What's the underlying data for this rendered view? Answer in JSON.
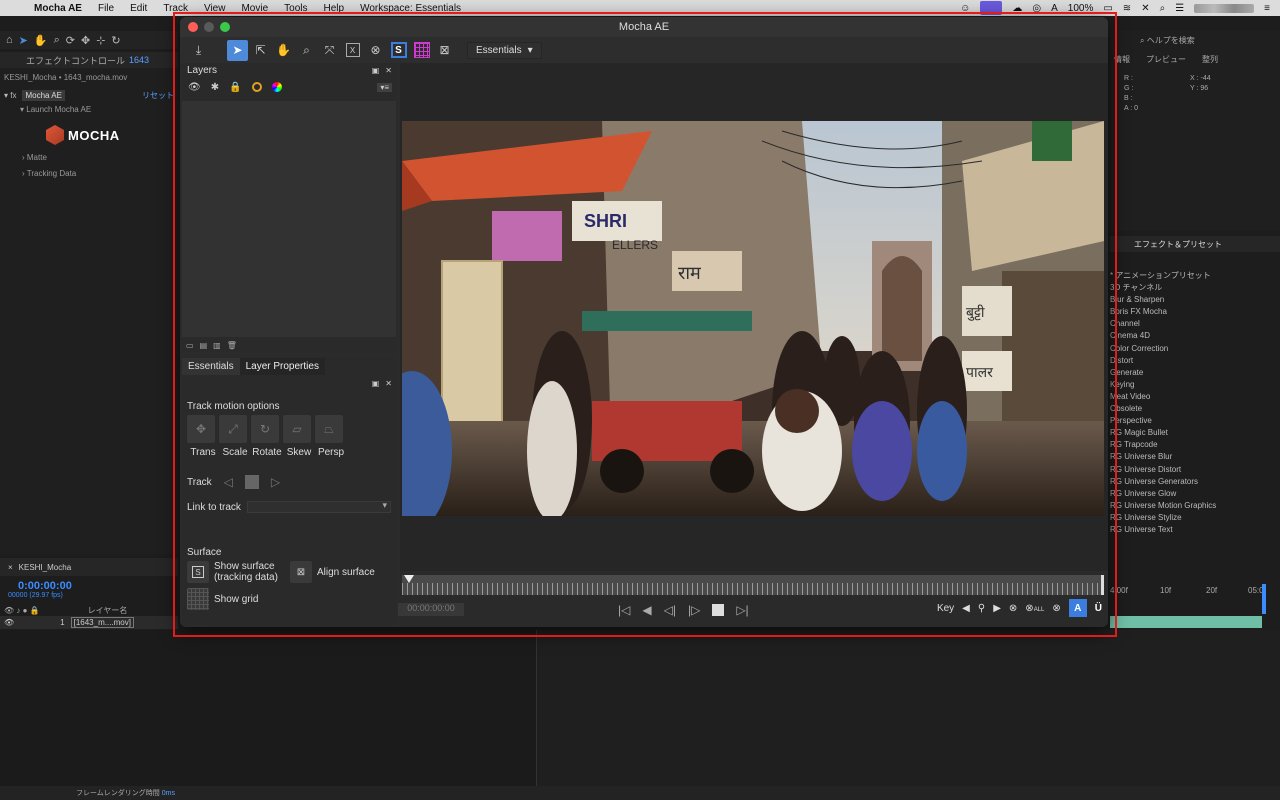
{
  "menubar": {
    "app": "Mocha AE",
    "items": [
      "File",
      "Edit",
      "Track",
      "View",
      "Movie",
      "Tools",
      "Help",
      "Workspace: Essentials"
    ],
    "battery": "100%"
  },
  "ae": {
    "effect_tab": "エフェクトコントロール",
    "effect_tab_suffix": "1643",
    "comp_path": "KESHI_Mocha • 1643_mocha.mov",
    "fx_name": "Mocha AE",
    "reset": "リセット",
    "launch": "Launch Mocha AE",
    "mocha_logo": "MOCHA",
    "tree_items": [
      "Matte",
      "Tracking Data"
    ],
    "search_placeholder": "ヘルプを検索",
    "info_tabs": [
      "情報",
      "プレビュー",
      "整列"
    ],
    "rgb": [
      "R :",
      "G :",
      "B :",
      "A : 0"
    ],
    "xy": [
      "X : -44",
      "Y : 96"
    ],
    "effects_header": "エフェクト＆プリセット",
    "effects_list": [
      "* アニメーションプリセット",
      "3D チャンネル",
      "Blur & Sharpen",
      "Boris FX Mocha",
      "Channel",
      "Cinema 4D",
      "Color Correction",
      "Distort",
      "Generate",
      "Keying",
      "Meat Video",
      "Obsolete",
      "Perspective",
      "RG Magic Bullet",
      "RG Trapcode",
      "RG Universe Blur",
      "RG Universe Distort",
      "RG Universe Generators",
      "RG Universe Glow",
      "RG Universe Motion Graphics",
      "RG Universe Stylize",
      "RG Universe Text"
    ],
    "timeline_tab": "KESHI_Mocha",
    "timecode": "0:00:00:00",
    "fps": "00000 (29.97 fps)",
    "layer_header": "レイヤー名",
    "layer_index": "1",
    "layer_name": "[1643_m....mov]",
    "ruler": [
      "4:00f",
      "10f",
      "20f",
      "05:0"
    ],
    "render_time_label": "フレームレンダリング時間",
    "render_time_value": "0ms"
  },
  "mocha": {
    "title": "Mocha AE",
    "workspace": "Essentials",
    "layers_title": "Layers",
    "tabs": [
      "Essentials",
      "Layer Properties"
    ],
    "track_motion_title": "Track motion options",
    "motion_labels": [
      "Trans",
      "Scale",
      "Rotate",
      "Skew",
      "Persp"
    ],
    "track_label": "Track",
    "link_label": "Link to track",
    "surface_title": "Surface",
    "show_surface": "Show surface",
    "show_surface_sub": "(tracking data)",
    "align_surface": "Align surface",
    "show_grid": "Show grid",
    "timeline_timecode": "00:00:00:00",
    "key_label": "Key",
    "all_label": "ALL",
    "video_signs": [
      "SHRI",
      "ELLERS",
      "राम",
      "बुट्टी",
      "पालर"
    ]
  }
}
